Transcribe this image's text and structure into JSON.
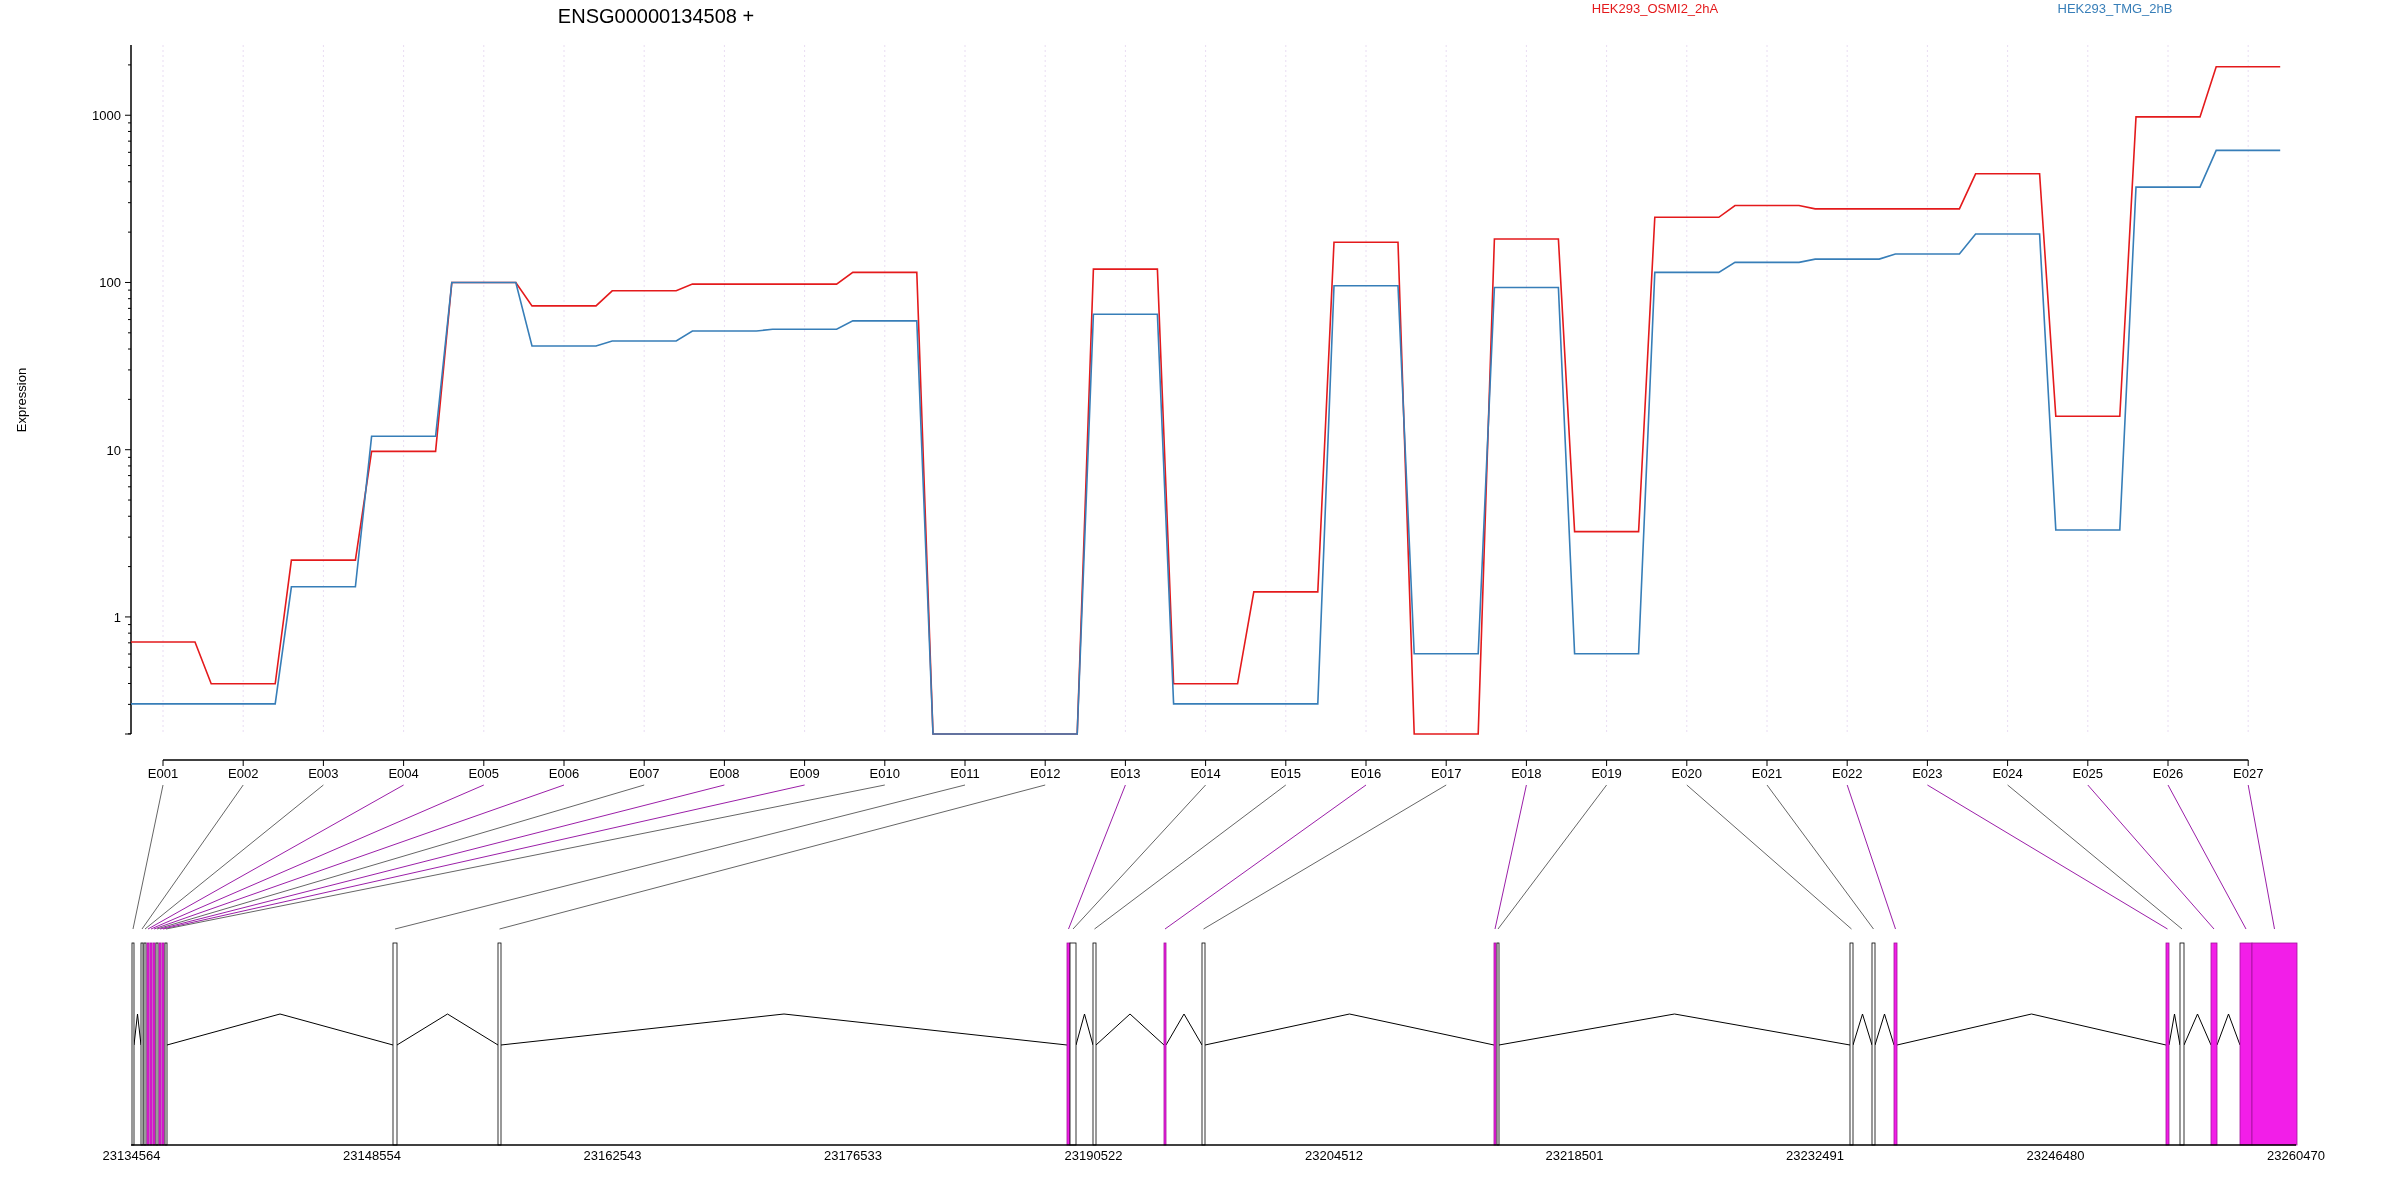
{
  "plot": {
    "title": "ENSG00000134508 +",
    "legend": [
      {
        "label": "HEK293_OSMI2_2hA",
        "color": "#e41a1c"
      },
      {
        "label": "HEK293_TMG_2hB",
        "color": "#377eb8"
      }
    ],
    "y_axis_title": "Expression",
    "y_tick_labels": [
      "1000",
      "100",
      "10",
      "1"
    ],
    "exon_labels": [
      "E001",
      "E002",
      "E003",
      "E004",
      "E005",
      "E006",
      "E007",
      "E008",
      "E009",
      "E010",
      "E011",
      "E012",
      "E013",
      "E014",
      "E015",
      "E016",
      "E017",
      "E018",
      "E019",
      "E020",
      "E021",
      "E022",
      "E023",
      "E024",
      "E025",
      "E026",
      "E027"
    ]
  },
  "gene_model": {
    "coordinate_labels": [
      "23134564",
      "23148554",
      "23162543",
      "23176533",
      "23190522",
      "23204512",
      "23218501",
      "23232491",
      "23246480",
      "23260470"
    ],
    "exons": [
      {
        "highlighted": false
      },
      {
        "highlighted": false
      },
      {
        "highlighted": false
      },
      {
        "highlighted": true
      },
      {
        "highlighted": true
      },
      {
        "highlighted": true
      },
      {
        "highlighted": false
      },
      {
        "highlighted": true
      },
      {
        "highlighted": true
      },
      {
        "highlighted": false
      },
      {
        "highlighted": false
      },
      {
        "highlighted": false
      },
      {
        "highlighted": true
      },
      {
        "highlighted": false
      },
      {
        "highlighted": false
      },
      {
        "highlighted": true
      },
      {
        "highlighted": false
      },
      {
        "highlighted": true
      },
      {
        "highlighted": false
      },
      {
        "highlighted": false
      },
      {
        "highlighted": false
      },
      {
        "highlighted": true
      },
      {
        "highlighted": true
      },
      {
        "highlighted": false
      },
      {
        "highlighted": true
      },
      {
        "highlighted": true
      },
      {
        "highlighted": true
      }
    ]
  }
}
